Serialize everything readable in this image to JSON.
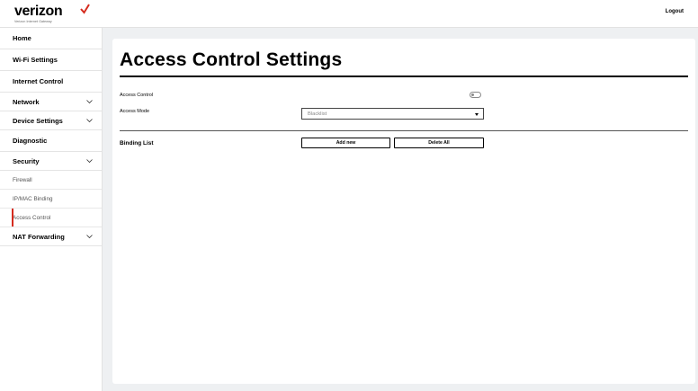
{
  "header": {
    "logo_text": "verizon",
    "logo_subtext": "Verizon Internet Gateway",
    "logout_label": "Logout",
    "brand_color": "#d52b1e"
  },
  "sidebar": {
    "items": [
      {
        "label": "Home",
        "expandable": false
      },
      {
        "label": "Wi-Fi Settings",
        "expandable": false
      },
      {
        "label": "Internet Control",
        "expandable": false
      },
      {
        "label": "Network",
        "expandable": true
      },
      {
        "label": "Device Settings",
        "expandable": true
      },
      {
        "label": "Diagnostic",
        "expandable": false
      },
      {
        "label": "Security",
        "expandable": true,
        "expanded": true
      }
    ],
    "security_subitems": [
      {
        "label": "Firewall",
        "active": false
      },
      {
        "label": "IP/MAC Binding",
        "active": false
      },
      {
        "label": "Access Control",
        "active": true
      }
    ],
    "nat": {
      "label": "NAT Forwarding",
      "expandable": true
    }
  },
  "main": {
    "title": "Access Control Settings",
    "access_control_label": "Access Control",
    "access_control_enabled": false,
    "access_mode_label": "Access Mode",
    "access_mode_value": "Blacklist",
    "binding_list_label": "Binding List",
    "add_new_label": "Add new",
    "delete_all_label": "Delete All"
  },
  "icons": {
    "chevron": "chevron-down-icon",
    "toggle": "toggle-switch",
    "caret": "caret-down-icon"
  }
}
